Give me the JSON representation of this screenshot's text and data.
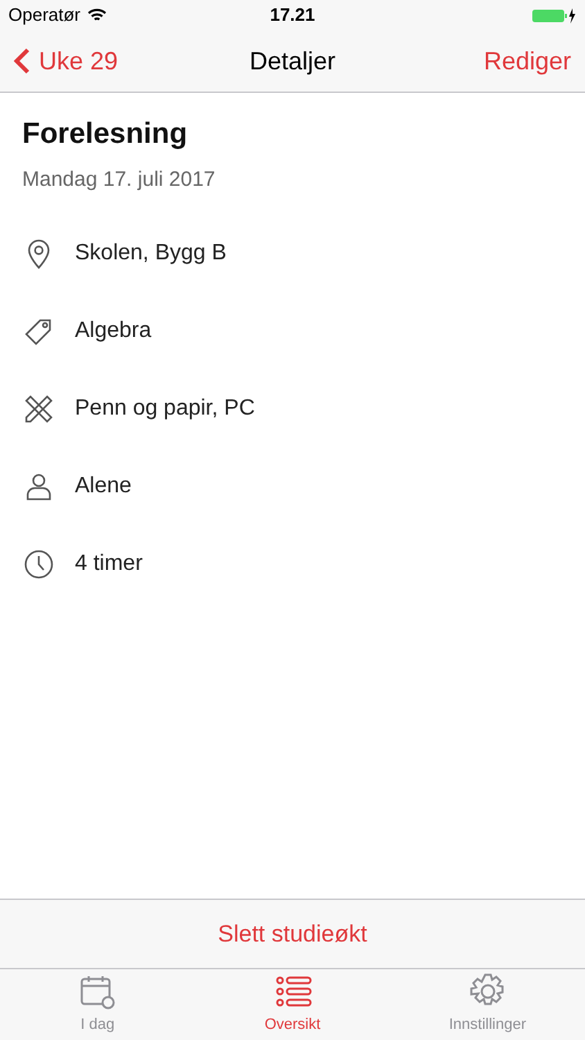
{
  "status_bar": {
    "carrier": "Operatør",
    "time": "17.21"
  },
  "nav": {
    "back": "Uke 29",
    "title": "Detaljer",
    "action": "Rediger"
  },
  "session": {
    "title": "Forelesning",
    "date": "Mandag 17. juli 2017"
  },
  "details": [
    {
      "kind": "location",
      "text": "Skolen, Bygg B"
    },
    {
      "kind": "tag",
      "text": "Algebra"
    },
    {
      "kind": "tools",
      "text": "Penn og papir, PC"
    },
    {
      "kind": "person",
      "text": "Alene"
    },
    {
      "kind": "clock",
      "text": "4 timer"
    }
  ],
  "delete_button": "Slett studieøkt",
  "tabs": [
    {
      "kind": "calendar",
      "label": "I dag",
      "selected": false
    },
    {
      "kind": "list",
      "label": "Oversikt",
      "selected": true
    },
    {
      "kind": "gear",
      "label": "Innstillinger",
      "selected": false
    }
  ]
}
